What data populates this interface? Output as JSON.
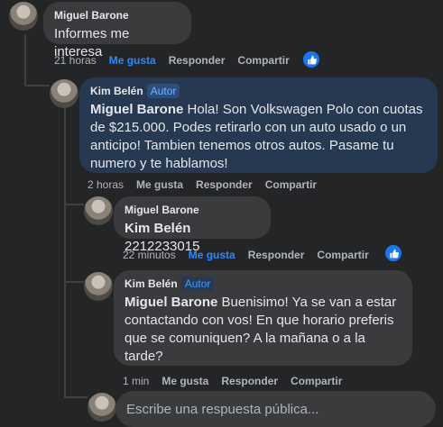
{
  "comments": [
    {
      "author": "Miguel Barone",
      "text": "Informes me interesa",
      "time": "21 horas",
      "like": "Me gusta",
      "reply": "Responder",
      "share": "Compartir"
    },
    {
      "author": "Kim Belén",
      "badge": "Autor",
      "mention": "Miguel Barone",
      "text": " Hola! Son Volkswagen Polo con cuotas de $215.000. Podes retirarlo con un auto usado o un anticipo! Tambien tenemos otros autos. Pasame tu numero y te hablamos!",
      "time": "2 horas",
      "like": "Me gusta",
      "reply": "Responder",
      "share": "Compartir"
    },
    {
      "author": "Miguel Barone",
      "mention": "Kim Belén",
      "text": " 2212233015",
      "time": "22 minutos",
      "like": "Me gusta",
      "reply": "Responder",
      "share": "Compartir"
    },
    {
      "author": "Kim Belén",
      "badge": "Autor",
      "mention": "Miguel Barone",
      "text": " Buenisimo! Ya se van a estar contactando con vos! En que horario preferis que se comuniquen? A la mañana o a la tarde?",
      "time": "1 min",
      "like": "Me gusta",
      "reply": "Responder",
      "share": "Compartir"
    }
  ],
  "reply_box": {
    "placeholder": "Escribe una respuesta pública..."
  },
  "colors": {
    "link_blue": "#2d88ff",
    "author_bubble": "#263951",
    "bubble": "#3a3b3c",
    "bg": "#242526"
  },
  "icons": {
    "reaction": "thumbs-up-icon"
  }
}
